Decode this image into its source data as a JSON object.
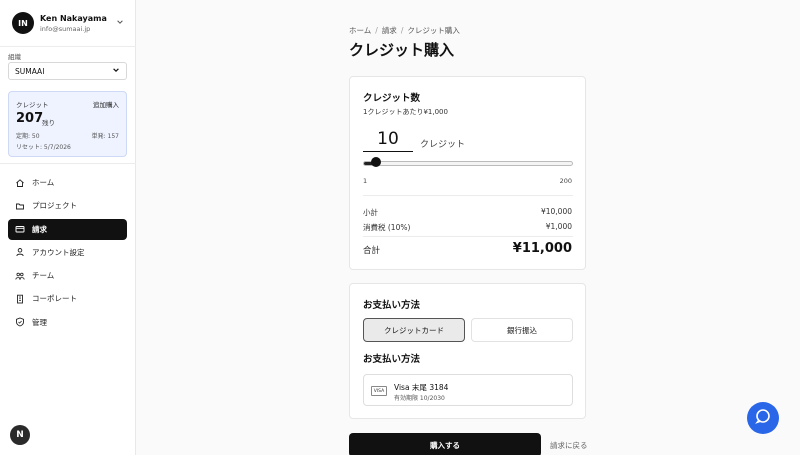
{
  "user": {
    "initials": "IN",
    "name": "Ken Nakayama",
    "email": "info@sumaai.jp"
  },
  "org": {
    "label": "組織",
    "selected": "SUMAAI"
  },
  "credits": {
    "label": "クレジット",
    "add": "追加購入",
    "amount": "207",
    "remaining": "残り",
    "fixed": "定期: 50",
    "single": "単発: 157",
    "reset": "リセット: 5/7/2026"
  },
  "nav": [
    {
      "label": "ホーム",
      "icon": "home-icon"
    },
    {
      "label": "プロジェクト",
      "icon": "folder-icon"
    },
    {
      "label": "請求",
      "icon": "credit-card-icon",
      "active": true
    },
    {
      "label": "アカウント設定",
      "icon": "user-icon"
    },
    {
      "label": "チーム",
      "icon": "team-icon"
    },
    {
      "label": "コーポレート",
      "icon": "building-icon"
    },
    {
      "label": "管理",
      "icon": "shield-icon"
    }
  ],
  "badge": "N",
  "breadcrumb": {
    "home": "ホーム",
    "billing": "請求",
    "current": "クレジット購入"
  },
  "title": "クレジット購入",
  "purchase": {
    "title": "クレジット数",
    "price_note": "1クレジットあたり¥1,000",
    "quantity": "10",
    "unit": "クレジット",
    "slider": {
      "min": 1,
      "max": 200,
      "value": 10,
      "min_label": "1",
      "max_label": "200"
    },
    "subtotal_label": "小計",
    "subtotal": "¥10,000",
    "tax_label": "消費税 (10%)",
    "tax": "¥1,000",
    "total_label": "合計",
    "total": "¥11,000"
  },
  "payment": {
    "title": "お支払い方法",
    "option_card": "クレジットカード",
    "option_bank": "銀行振込",
    "subtitle": "お支払い方法",
    "card_brand": "VISA",
    "card_name": "Visa 末尾 3184",
    "card_exp": "有効期限 10/2030"
  },
  "actions": {
    "buy": "購入する",
    "back": "請求に戻る"
  },
  "colors": {
    "accent": "#2a66e8",
    "primary": "#111111",
    "credit_bg": "#eef3ff"
  }
}
